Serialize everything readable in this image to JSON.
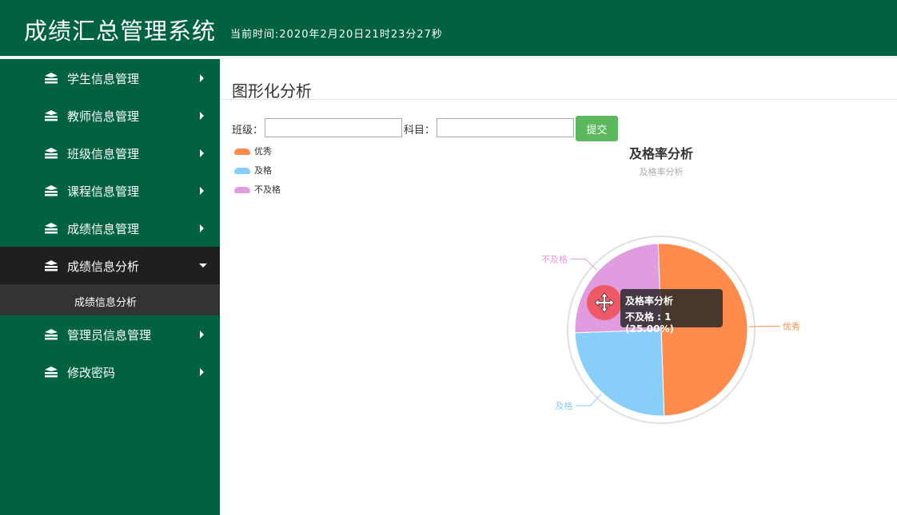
{
  "header": {
    "title": "成绩汇总管理系统",
    "time": "当前时间:2020年2月20日21时23分27秒"
  },
  "sidebar": {
    "items": [
      {
        "label": "学生信息管理"
      },
      {
        "label": "教师信息管理"
      },
      {
        "label": "班级信息管理"
      },
      {
        "label": "课程信息管理"
      },
      {
        "label": "成绩信息管理"
      },
      {
        "label": "成绩信息分析"
      },
      {
        "label": "管理员信息管理"
      },
      {
        "label": "修改密码"
      }
    ],
    "active_sub_item": "成绩信息分析"
  },
  "main": {
    "page_title": "图形化分析",
    "form": {
      "class_label": "班级：",
      "class_value": "",
      "subject_label": "科目：",
      "subject_value": "",
      "submit_label": "提交"
    }
  },
  "tooltip": {
    "title": "及格率分析",
    "line": "不及格 : 1 (25.00%)"
  },
  "colors": {
    "header_bg": "#006241",
    "sidebar_bg": "#006241",
    "active_bg": "#1f1f1f",
    "sub_bg": "#333333",
    "submit_bg": "#5cb85c"
  },
  "chart_data": {
    "type": "pie",
    "title": "及格率分析",
    "subtitle": "及格率分析",
    "legend_position": "top-left",
    "categories": [
      "优秀",
      "及格",
      "不及格"
    ],
    "values": [
      2,
      1,
      1
    ],
    "colors": [
      "#ff8c4c",
      "#87cefa",
      "#e19ce0"
    ],
    "highlighted": "不及格"
  }
}
